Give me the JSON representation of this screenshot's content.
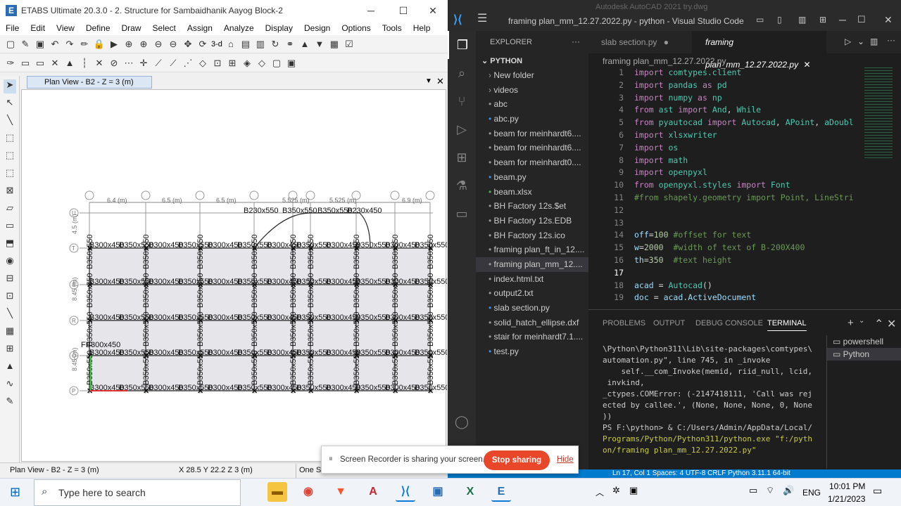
{
  "etabs": {
    "title": "ETABS Ultimate 20.3.0 - 2. Structure for Sambaidhanik Aayog Block-2",
    "menu": [
      "File",
      "Edit",
      "View",
      "Define",
      "Draw",
      "Select",
      "Assign",
      "Analyze",
      "Display",
      "Design",
      "Options",
      "Tools",
      "Help"
    ],
    "toolbar_3d": "3-d",
    "view_tab": "Plan View - B2 - Z = 3 (m)",
    "dims_top": [
      "6.4 (m)",
      "6.5 (m)",
      "6.5 (m)",
      "5.525 (m)",
      "5.525 (m)",
      "6.9 (m)"
    ],
    "dims_left": [
      "4.5 (m)",
      "8.45 (m)",
      "8.45 (m)"
    ],
    "grid_labels_left": [
      "U",
      "T",
      "S",
      "R",
      "Q",
      "P"
    ],
    "beam_labels": [
      "B230x550",
      "B350x550",
      "B350x550",
      "B230x450",
      "B350x550",
      "B300x450",
      "B300x450",
      "FB300x450"
    ],
    "status_view": "Plan View - B2 - Z = 3 (m)",
    "status_coords": "X 28.5  Y 22.2  Z 3 (m)",
    "status_one": "One St"
  },
  "vscode": {
    "title": "framing plan_mm_12.27.2022.py - python - Visual Studio Code",
    "autocad_title": "Autodesk AutoCAD 2021   try.dwg",
    "explorer_header": "EXPLORER",
    "folder": "PYTHON",
    "files": [
      "New folder",
      "videos",
      "abc",
      "abc.py",
      "beam for meinhardt6....",
      "beam for meinhardt6....",
      "beam for meinhardt0....",
      "beam.py",
      "beam.xlsx",
      "BH Factory 12s.$et",
      "BH Factory 12s.EDB",
      "BH Factory 12s.ico",
      "framing plan_ft_in_12....",
      "framing plan_mm_12....",
      "index.html.txt",
      "output2.txt",
      "slab section.py",
      "solid_hatch_ellipse.dxf",
      "stair for meinhardt7.1....",
      "test.py"
    ],
    "tabs": [
      "slab section.py",
      "framing plan_mm_12.27.2022.py"
    ],
    "breadcrumb": "framing plan_mm_12.27.2022.py",
    "line_numbers": [
      "1",
      "2",
      "3",
      "4",
      "5",
      "6",
      "7",
      "8",
      "9",
      "10",
      "11",
      "12",
      "13",
      "14",
      "15",
      "16",
      "17",
      "18",
      "19"
    ],
    "panel_tabs": [
      "PROBLEMS",
      "OUTPUT",
      "DEBUG CONSOLE",
      "TERMINAL"
    ],
    "terminal_lines": [
      "\\Python\\Python311\\Lib\\site-packages\\comtypes\\",
      "automation.py\", line 745, in _invoke",
      "    self.__com_Invoke(memid, riid_null, lcid,",
      " invkind,",
      "_ctypes.COMError: (-2147418111, 'Call was rej",
      "ected by callee.', (None, None, None, 0, None",
      "))",
      "PS F:\\python> & C:/Users/Admin/AppData/Local/",
      "Programs/Python/Python311/python.exe \"f:/pyth",
      "on/framing plan_mm_12.27.2022.py\""
    ],
    "shells": [
      "powershell",
      "Python"
    ],
    "status": "Ln 17, Col 1    Spaces: 4    UTF-8    CRLF    Python    3.11.1 64-bit"
  },
  "recorder": {
    "text": "Screen Recorder is sharing your screen.",
    "stop": "Stop sharing",
    "hide": "Hide"
  },
  "taskbar": {
    "search_placeholder": "Type here to search",
    "lang": "ENG",
    "time": "10:01 PM",
    "date": "1/21/2023"
  }
}
